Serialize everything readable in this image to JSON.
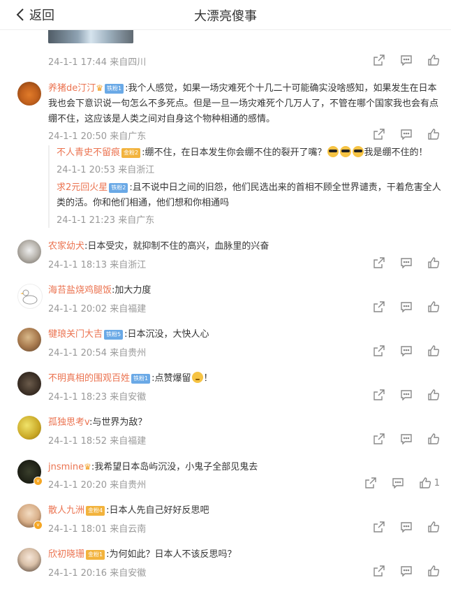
{
  "header": {
    "back_label": "返回",
    "title": "大漂亮傻事"
  },
  "top_item": {
    "meta": "24-1-1 17:44 来自四川"
  },
  "comments": [
    {
      "name": "养猪de汀汀",
      "badge": "铁粉1",
      "text": ":我个人感觉，如果一场灾难死个十几二十可能确实没啥感知，如果发生在日本我也会下意识说一句怎么不多死点。但是一旦一场灾难死个几万人了，不管在哪个国家我也会有点绷不住，这应该是人类之间对自身这个物种相通的感情。",
      "meta": "24-1-1 20:50 来自广东",
      "replies": [
        {
          "name": "不人青史不留痕",
          "badge": "金粉2",
          "text": ":绷不住，在日本发生你会绷不住的裂开了嘴？",
          "text_tail": "我是绷不住的！",
          "meta": "24-1-1 20:53 来自浙江"
        },
        {
          "name": "求2元回火星",
          "badge": "铁粉2",
          "text": ":且不说中日之间的旧怨，他们民选出来的首相不顾全世界谴责，干着危害全人类的活。你和他们相通，他们想和你相通吗",
          "meta": "24-1-1 21:23 来自广东"
        }
      ]
    },
    {
      "name": "农家幼犬",
      "text": ":日本受灾，就抑制不住的高兴，血脉里的兴奋",
      "meta": "24-1-1 18:13 来自浙江"
    },
    {
      "name": "海苔盐烧鸡腿饭",
      "text": ":加大力度",
      "meta": "24-1-1 20:02 来自福建"
    },
    {
      "name": "犍琅关门大吉",
      "badge": "铁粉5",
      "text": ":日本沉没，大快人心",
      "meta": "24-1-1 20:54 来自贵州"
    },
    {
      "name": "不明真相的围观百姓",
      "badge": "铁粉1",
      "text": ":点赞爆留",
      "text_tail": "！",
      "meta": "24-1-1 18:23 来自安徽"
    },
    {
      "name": "孤独思考v",
      "text": ":与世界为敌？",
      "meta": "24-1-1 18:52 来自福建"
    },
    {
      "name": "jnsmine",
      "text": ":我希望日本岛屿沉没，小鬼子全部见鬼去",
      "meta": "24-1-1 20:20 来自贵州",
      "likes": "1"
    },
    {
      "name": "散人九洲",
      "badge": "金粉4",
      "text": ":日本人先自己好好反思吧",
      "meta": "24-1-1 18:01 来自云南"
    },
    {
      "name": "欣初晓珊",
      "badge": "金粉1",
      "text": ":为何如此？日本人不该反思吗？",
      "meta": "24-1-1 20:16 来自安徽"
    }
  ],
  "icons": {
    "share": "share-icon",
    "comment": "comment-icon",
    "like": "like-icon",
    "back": "chevron-left-icon"
  },
  "colors": {
    "username": "#eb7350",
    "meta": "#999999",
    "iron_fan": "#6aa9e6",
    "gold_fan": "#f2b33d"
  }
}
